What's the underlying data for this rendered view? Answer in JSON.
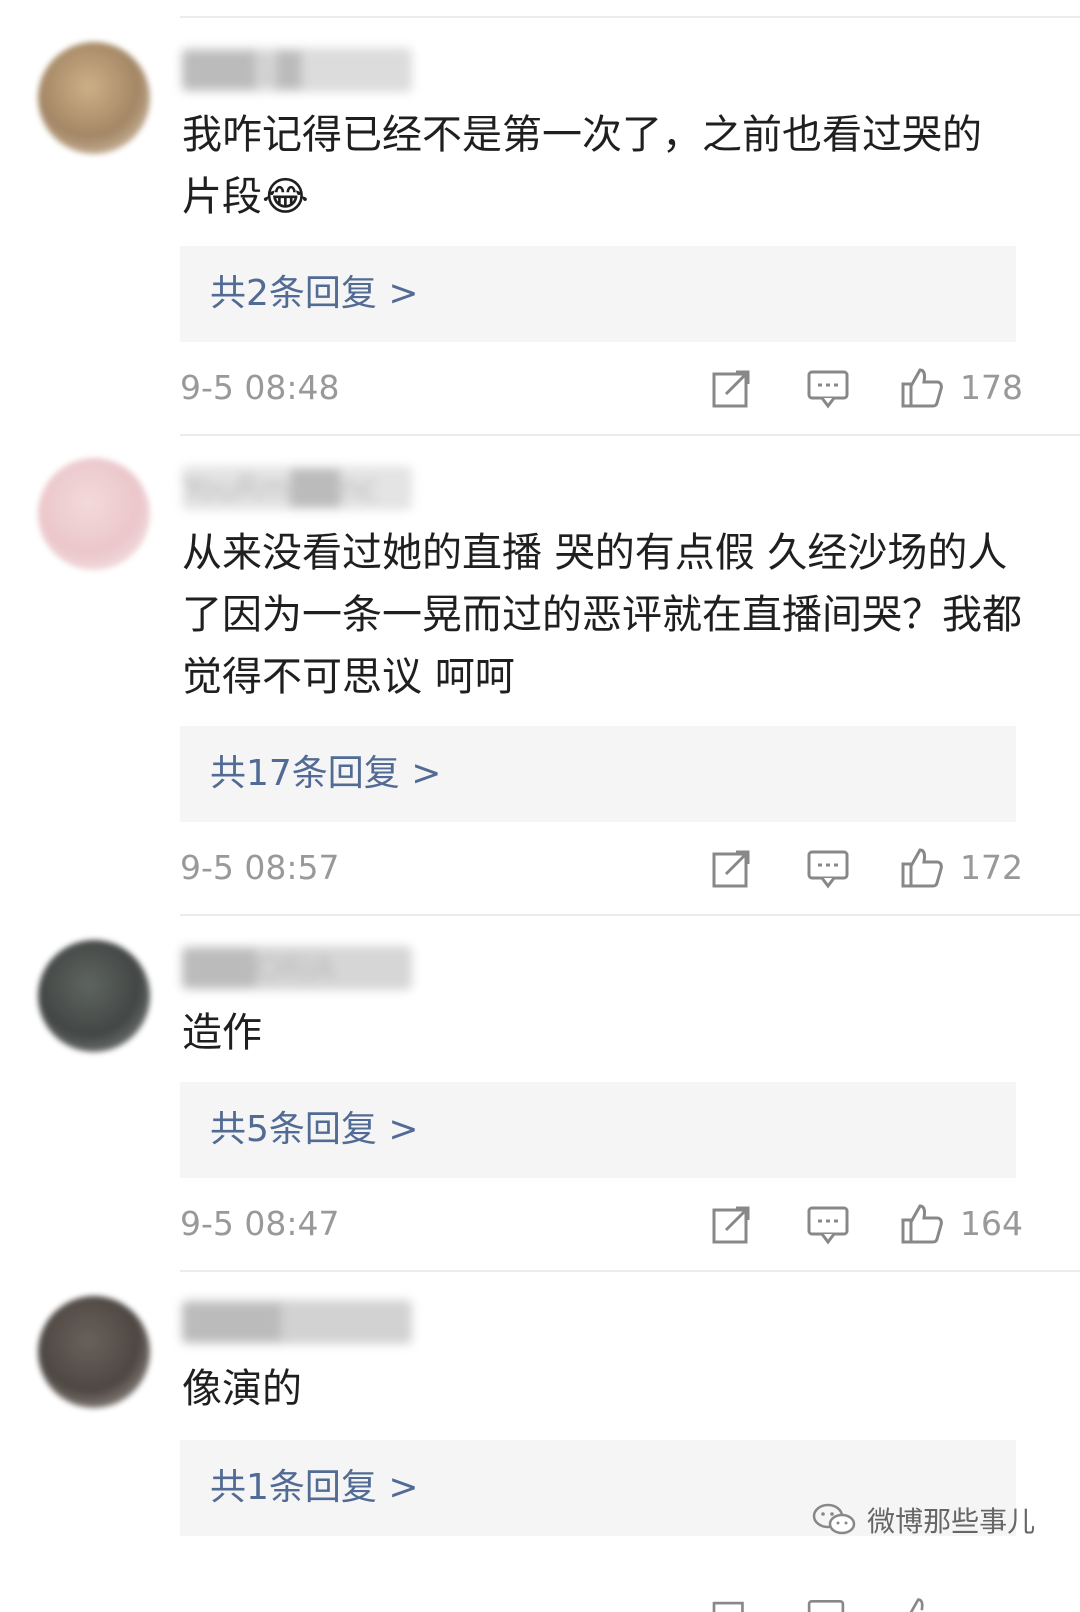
{
  "comments": [
    {
      "username": "███1█",
      "text": "我咋记得已经不是第一次了，之前也看过哭的片段😂",
      "replies": "共2条回复 >",
      "time": "9-5 08:48",
      "likes": "178"
    },
    {
      "username": "YouRm██nc",
      "text": "从来没看过她的直播 哭的有点假 久经沙场的人了因为一条一晃而过的恶评就在直播间哭？我都觉得不可思议 呵呵",
      "replies": "共17条回复 >",
      "time": "9-5 08:57",
      "likes": "172"
    },
    {
      "username": "███ORIA",
      "text": "造作",
      "replies": "共5条回复 >",
      "time": "9-5 08:47",
      "likes": "164"
    },
    {
      "username": "████",
      "text": "像演的",
      "replies": "共1条回复 >"
    }
  ],
  "watermark": {
    "text": "微博那些事儿",
    "icon": "wechat-icon"
  },
  "colors": {
    "link": "#526b94",
    "reply_bg": "#f5f5f5",
    "meta": "#999999",
    "text": "#1f1f1f"
  },
  "icons": [
    "repost-icon",
    "comment-icon",
    "like-icon"
  ]
}
